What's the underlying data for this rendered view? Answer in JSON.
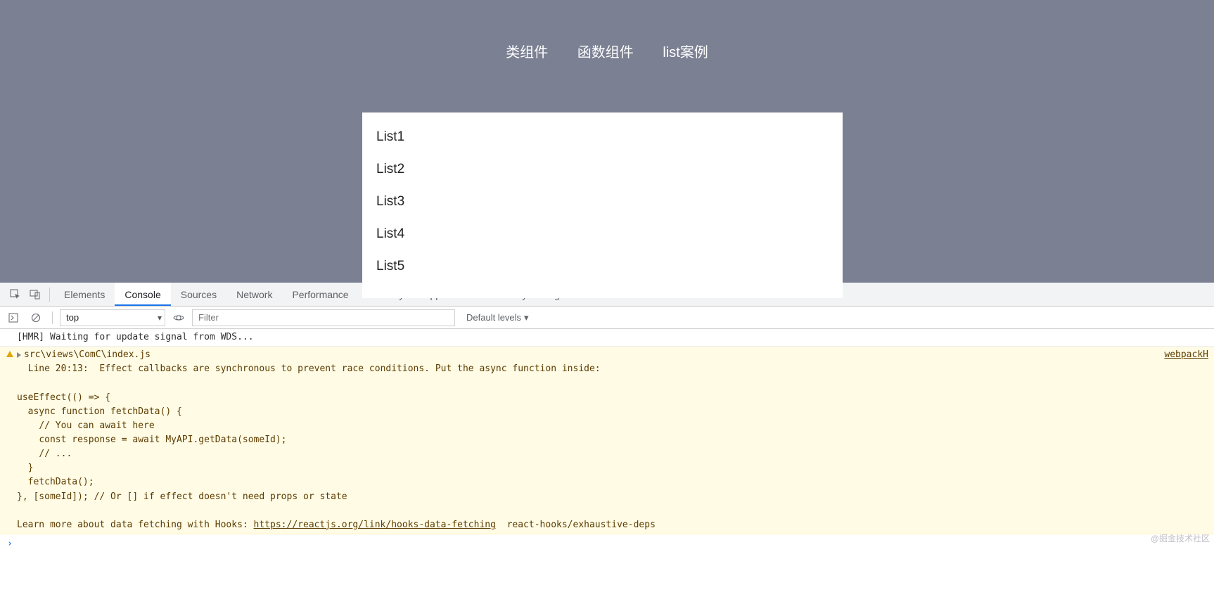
{
  "app": {
    "nav_items": [
      "类组件",
      "函数组件",
      "list案例"
    ],
    "card_items": [
      "List1",
      "List2",
      "List3",
      "List4",
      "List5"
    ]
  },
  "devtools": {
    "tabs": [
      "Elements",
      "Console",
      "Sources",
      "Network",
      "Performance",
      "Memory",
      "Application",
      "Security",
      "Lighthouse"
    ],
    "active_tab": "Console",
    "toolbar": {
      "context": "top",
      "filter_placeholder": "Filter",
      "levels_label": "Default levels"
    },
    "messages": {
      "hmr": "[HMR] Waiting for update signal from WDS...",
      "warn_file_line": "src\\views\\ComC\\index.js",
      "warn_source_link": "webpackH",
      "warn_body": "  Line 20:13:  Effect callbacks are synchronous to prevent race conditions. Put the async function inside:\n\nuseEffect(() => {\n  async function fetchData() {\n    // You can await here\n    const response = await MyAPI.getData(someId);\n    // ...\n  }\n  fetchData();\n}, [someId]); // Or [] if effect doesn't need props or state\n\nLearn more about data fetching with Hooks: ",
      "warn_link_text": "https://reactjs.org/link/hooks-data-fetching",
      "warn_tail": "  react-hooks/exhaustive-deps"
    }
  },
  "watermark": "@掘金技术社区"
}
